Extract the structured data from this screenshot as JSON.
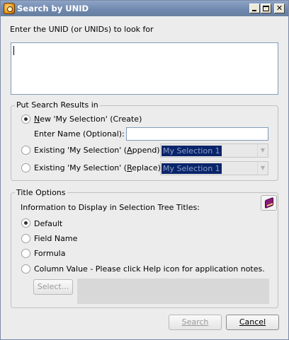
{
  "window": {
    "title": "Search by UNID"
  },
  "prompt": "Enter the UNID (or UNIDs) to look for",
  "results_group": {
    "legend": "Put Search Results in",
    "new_option": {
      "prefix": "N",
      "rest": "ew 'My Selection' (Create)",
      "checked": true
    },
    "name_label": "Enter Name (Optional):",
    "name_value": "",
    "append_option": {
      "before": "Existing 'My Selection' (",
      "key": "A",
      "after": "ppend):",
      "checked": false
    },
    "append_combo": {
      "value": "My Selection 1"
    },
    "replace_option": {
      "before": "Existing 'My Selection' (",
      "key": "R",
      "after": "eplace):",
      "checked": false
    },
    "replace_combo": {
      "value": "My Selection 1"
    }
  },
  "title_group": {
    "legend": "Title Options",
    "info_label": "Information to Display in Selection Tree Titles:",
    "options": [
      {
        "label": "Default",
        "checked": true
      },
      {
        "label": "Field Name",
        "checked": false
      },
      {
        "label": "Formula",
        "checked": false
      },
      {
        "label": "Column Value -  Please click Help icon for application notes.",
        "checked": false
      }
    ],
    "select_button": "Select..."
  },
  "footer": {
    "search_button": "Search",
    "cancel_button": "Cancel"
  }
}
